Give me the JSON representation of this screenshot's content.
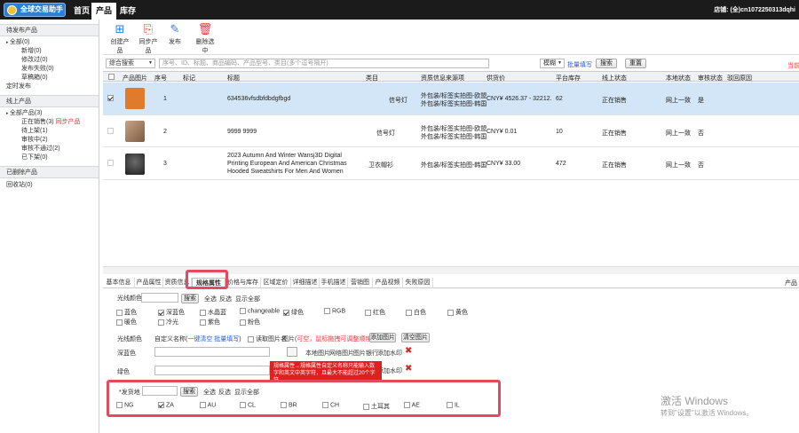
{
  "topbar": {
    "logo": "全球交易助手",
    "tabs": [
      "首页",
      "产品",
      "库存"
    ],
    "shop": "店铺: (全)cn1072250313dqhi"
  },
  "sidebar": {
    "sections": [
      {
        "title": "待发布产品",
        "items": [
          "全部(0)",
          "新增(0)",
          "修改过(0)",
          "发布失败(0)",
          "草稿箱(0)",
          "定时发布"
        ]
      },
      {
        "title": "线上产品",
        "items": [
          "全部产品(3)",
          "正在销售(3)",
          "同步产品",
          "待上架(1)",
          "审核中(2)",
          "审核不通过(2)",
          "已下架(0)"
        ]
      },
      {
        "title": "已删除产品",
        "items": [
          "回收站(0)"
        ]
      }
    ]
  },
  "toolbar": {
    "buttons": [
      "创建产品",
      "同步产品",
      "发布",
      "删除选中"
    ]
  },
  "search": {
    "combo": "综合搜索",
    "placeholder": "序号、ID、标题、商品编码、产品型号、类目(多个逗号隔开)",
    "mode": "模糊",
    "batch": "批量填写",
    "search_btn": "搜索",
    "reset_btn": "重置",
    "right_link": "当前选"
  },
  "table": {
    "headers": [
      "产品图片",
      "序号",
      "标记",
      "标题",
      "类目",
      "资质信息来源项",
      "供货价",
      "平台库存",
      "线上状态",
      "本地状态",
      "审核状态",
      "驳回原因"
    ],
    "rows": [
      {
        "index": "1",
        "title": "634536vfsdbfdbdgfbgd",
        "category": "信号灯",
        "source1": "外包装/标签实拍图-欧盟",
        "source2": "外包装/标签实拍图-韩国",
        "price": "CNY¥ 4526.37 - 32212.",
        "stock": "62",
        "online": "正在销售",
        "local": "网上一致",
        "audit": "是"
      },
      {
        "index": "2",
        "title": "9999  9999",
        "category": "信号灯",
        "source1": "外包装/标签实拍图-欧盟",
        "source2": "外包装/标签实拍图-韩国",
        "price": "CNY¥ 0.01",
        "stock": "10",
        "online": "正在销售",
        "local": "网上一致",
        "audit": "否"
      },
      {
        "index": "3",
        "title_lines": [
          "2023 Autumn And Winter Wansj3D Digital",
          "Printing European And American Christmas",
          "Hooded Sweatshirts For Men And Women"
        ],
        "category": "卫衣帽衫",
        "source1": "外包装/标签实拍图-韩国",
        "price": "CNY¥ 33.00",
        "stock": "472",
        "online": "正在销售",
        "local": "网上一致",
        "audit": "否"
      }
    ]
  },
  "tabs": [
    "基本信息",
    "产品属性",
    "资质信息",
    "规格属性",
    "价格与库存",
    "区域定价",
    "详细描述",
    "手机描述",
    "营销图",
    "产品视频",
    "失败原因"
  ],
  "right_label": "产品",
  "attr": {
    "color_label": "光线颜色",
    "search_btn": "搜索",
    "select_all": "全选",
    "invert": "反选",
    "show_all": "显示全部",
    "colors": [
      {
        "name": "蓝色",
        "checked": false
      },
      {
        "name": "深蓝色",
        "checked": true
      },
      {
        "name": "水晶蓝",
        "checked": false
      },
      {
        "name": "changeable",
        "checked": false
      },
      {
        "name": "绿色",
        "checked": true
      },
      {
        "name": "RGB",
        "checked": false
      },
      {
        "name": "红色",
        "checked": false
      },
      {
        "name": "白色",
        "checked": false
      },
      {
        "name": "黄色",
        "checked": false
      },
      {
        "name": "暖色",
        "checked": false
      },
      {
        "name": "冷光",
        "checked": false
      },
      {
        "name": "紫色",
        "checked": false
      },
      {
        "name": "粉色",
        "checked": false
      }
    ],
    "row_title": "光线颜色",
    "custom_name": "自定义名称(",
    "one_key": "一键清空",
    "batch": "批量填写",
    "read_pic": "读取图片名",
    "pic_label": "图片(",
    "pic_hint": "可空，鼠标拖拽可调整顺序",
    "pic_close": ")",
    "add_pic": "添加图片",
    "clear_pic": "清空图片",
    "variants": [
      "深蓝色",
      "绿色"
    ],
    "img_links": [
      "本地图片",
      "网络图片",
      "图片银行",
      "添加水印"
    ],
    "tooltip": "规格属性→规格属性自定义名称只能输入数字和英文中英字符，且最大不能超过20个字符",
    "ship_label": "*发货地",
    "ship": [
      {
        "name": "NG",
        "checked": false
      },
      {
        "name": "ZA",
        "checked": true
      },
      {
        "name": "AU",
        "checked": false
      },
      {
        "name": "CL",
        "checked": false
      },
      {
        "name": "BR",
        "checked": false
      },
      {
        "name": "CH",
        "checked": false
      },
      {
        "name": "土耳其",
        "checked": false
      },
      {
        "name": "AE",
        "checked": false
      },
      {
        "name": "IL",
        "checked": false
      }
    ]
  },
  "watermark": {
    "line1": "激活 Windows",
    "line2": "转到\"设置\"以激活 Windows。"
  },
  "colors": {
    "accent": "#2b7dd8",
    "highlight_box": "#e04b5e",
    "selected_row": "#d3e6f7",
    "topbar": "#1b1b1b"
  }
}
